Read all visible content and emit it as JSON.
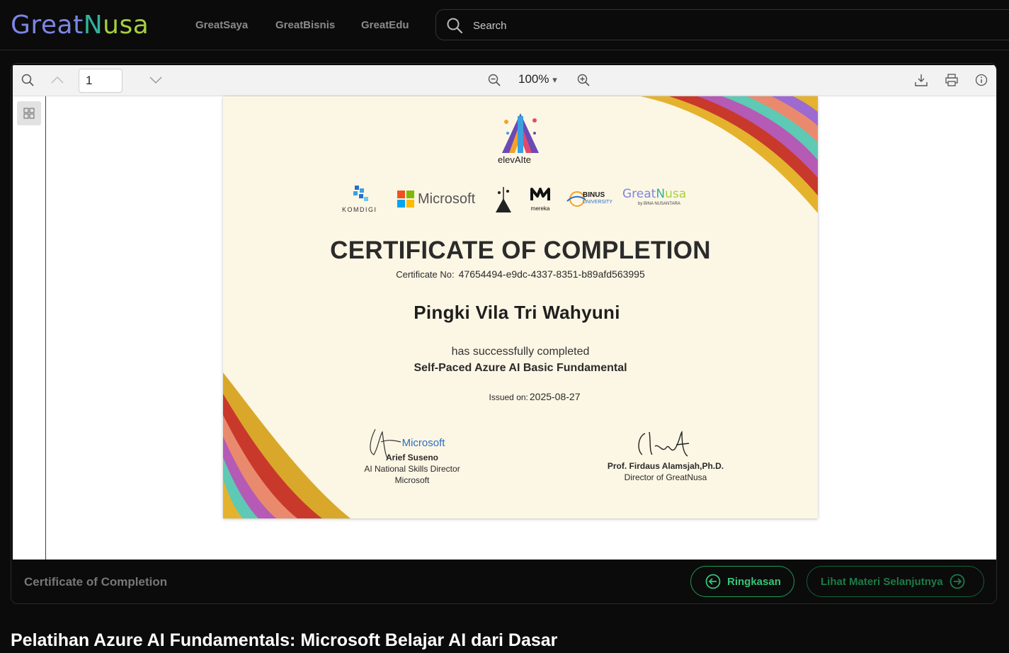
{
  "header": {
    "logo": {
      "part1": "Great",
      "part2": "N",
      "part3": "usa"
    },
    "nav": [
      "GreatSaya",
      "GreatBisnis",
      "GreatEdu"
    ],
    "search_placeholder": "Search"
  },
  "viewer": {
    "page_number": "1",
    "zoom": "100%",
    "zoom_caret": "▾"
  },
  "certificate": {
    "program_logo_text": "elevAIte",
    "partners": [
      "KOMDIGI",
      "Microsoft",
      "mereka",
      "BINUS",
      "UNIVERSITY",
      "Great",
      "usa",
      "by BINA NUSANTARA"
    ],
    "title": "CERTIFICATE OF COMPLETION",
    "cert_no_label": "Certificate No:",
    "cert_no": "47654494-e9dc-4337-8351-b89afd563995",
    "recipient": "Pingki Vila Tri Wahyuni",
    "completed_text": "has successfully completed",
    "course": "Self-Paced Azure AI Basic Fundamental",
    "issued_label": "Issued on:",
    "issued_date": "2025-08-27",
    "signatories": [
      {
        "logo": "Microsoft",
        "name": "Arief Suseno",
        "role": "AI National Skills Director",
        "org": "Microsoft"
      },
      {
        "name": "Prof. Firdaus Alamsjah,Ph.D.",
        "role": "Director of GreatNusa"
      }
    ]
  },
  "footer": {
    "doc_label": "Certificate of Completion",
    "summary_button": "Ringkasan",
    "next_button": "Lihat Materi Selanjutnya"
  },
  "course_heading": "Pelatihan Azure AI Fundamentals: Microsoft Belajar AI dari Dasar",
  "colors": {
    "accent_green": "#35c478",
    "logo_blue": "#7c86e6",
    "logo_teal": "#2fb39a",
    "logo_lime": "#a7cf3f",
    "cert_bg": "#fcf6e4"
  }
}
